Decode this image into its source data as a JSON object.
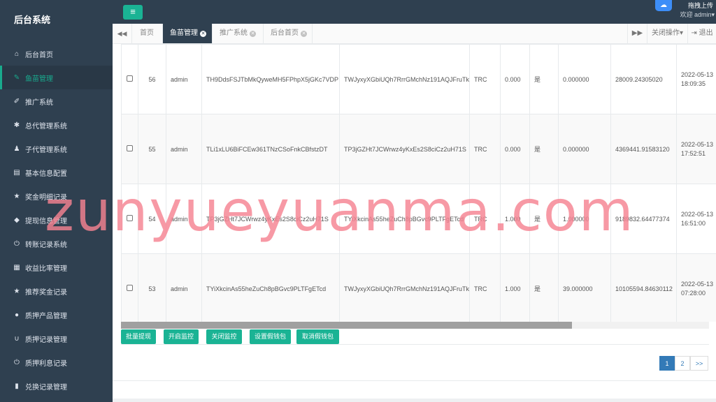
{
  "app": {
    "title": "后台系统"
  },
  "topbar": {
    "menu_icon": "menu-icon",
    "upload_label": "拖拽上传",
    "welcome_text": "欢迎 admin"
  },
  "sidebar": {
    "items": [
      {
        "label": "后台首页",
        "icon": "home-icon",
        "glyph": "⌂"
      },
      {
        "label": "鱼苗管理",
        "icon": "wrench-icon",
        "glyph": "✎",
        "active": true
      },
      {
        "label": "推广系统",
        "icon": "edit-icon",
        "glyph": "✐"
      },
      {
        "label": "总代管理系统",
        "icon": "asterisk-icon",
        "glyph": "✱"
      },
      {
        "label": "子代管理系统",
        "icon": "users-icon",
        "glyph": "♟"
      },
      {
        "label": "基本信息配置",
        "icon": "file-icon",
        "glyph": "▤"
      },
      {
        "label": "奖金明细记录",
        "icon": "star-icon",
        "glyph": "★"
      },
      {
        "label": "提现信息管理",
        "icon": "tag-icon",
        "glyph": "◆"
      },
      {
        "label": "转账记录系统",
        "icon": "power-icon",
        "glyph": "⏻"
      },
      {
        "label": "收益比率管理",
        "icon": "calendar-icon",
        "glyph": "▦"
      },
      {
        "label": "推荐奖金记录",
        "icon": "star-icon",
        "glyph": "★"
      },
      {
        "label": "质押产品管理",
        "icon": "comment-icon",
        "glyph": "●"
      },
      {
        "label": "质押记录管理",
        "icon": "magnet-icon",
        "glyph": "∪"
      },
      {
        "label": "质押利息记录",
        "icon": "power-icon",
        "glyph": "⏻"
      },
      {
        "label": "兑换记录管理",
        "icon": "book-icon",
        "glyph": "▮"
      }
    ]
  },
  "tabs": {
    "prev_icon": "double-left-icon",
    "next_icon": "double-right-icon",
    "items": [
      {
        "label": "首页",
        "closable": false
      },
      {
        "label": "鱼苗管理",
        "closable": true,
        "active": true
      },
      {
        "label": "推广系统",
        "closable": true
      },
      {
        "label": "后台首页",
        "closable": true
      }
    ],
    "close_ops": "关闭操作",
    "logout": "退出"
  },
  "table": {
    "rows": [
      {
        "id": "56",
        "user": "admin",
        "address": "TH9DdsFSJTbMkQyweMH5FPhpX5jGKc7VDP",
        "auth_address": "TWJyxyXGbiUQh7RrrGMchNz191AQJFruTk",
        "chain": "TRC",
        "amount": "0.000",
        "flag": "是",
        "balance": "0.000000",
        "total": "28009.24305020",
        "date": "2022-05-13",
        "time": "18:09:35"
      },
      {
        "id": "55",
        "user": "admin",
        "address": "TLi1xLU6BiFCEw361TNzCSoFnkCBfstzDT",
        "auth_address": "TP3jGZHt7JCWrwz4yKxEs2S8ciCz2uH71S",
        "chain": "TRC",
        "amount": "0.000",
        "flag": "是",
        "balance": "0.000000",
        "total": "4369441.91583120",
        "date": "2022-05-13",
        "time": "17:52:51"
      },
      {
        "id": "54",
        "user": "admin",
        "address": "TP3jGZHt7JCWrwz4yKxEs2S8ciCz2uH71S",
        "auth_address": "TYiXkcinAs55heZuCh8pBGvc9PLTFgETcd",
        "chain": "TRC",
        "amount": "1.000",
        "flag": "是",
        "balance": "1.000000",
        "total": "9189832.64477374",
        "date": "2022-05-13",
        "time": "16:51:00"
      },
      {
        "id": "53",
        "user": "admin",
        "address": "TYiXkcinAs55heZuCh8pBGvc9PLTFgETcd",
        "auth_address": "TWJyxyXGbiUQh7RrrGMchNz191AQJFruTk",
        "chain": "TRC",
        "amount": "1.000",
        "flag": "是",
        "balance": "39.000000",
        "total": "10105594.84630112",
        "date": "2022-05-13",
        "time": "07:28:00"
      }
    ]
  },
  "actions": {
    "batch_withdraw": "批量提现",
    "start_monitor": "开启监控",
    "stop_monitor": "关闭监控",
    "set_fake_wallet": "设置假钱包",
    "cancel_fake_wallet": "取消假钱包"
  },
  "pagination": {
    "pages": [
      "1",
      "2"
    ],
    "next": ">>",
    "current": "1"
  },
  "watermark": "zunyueyuanma.com",
  "colors": {
    "sidebar_bg": "#2f4050",
    "accent": "#1ab394",
    "pager_active": "#337ab7"
  }
}
